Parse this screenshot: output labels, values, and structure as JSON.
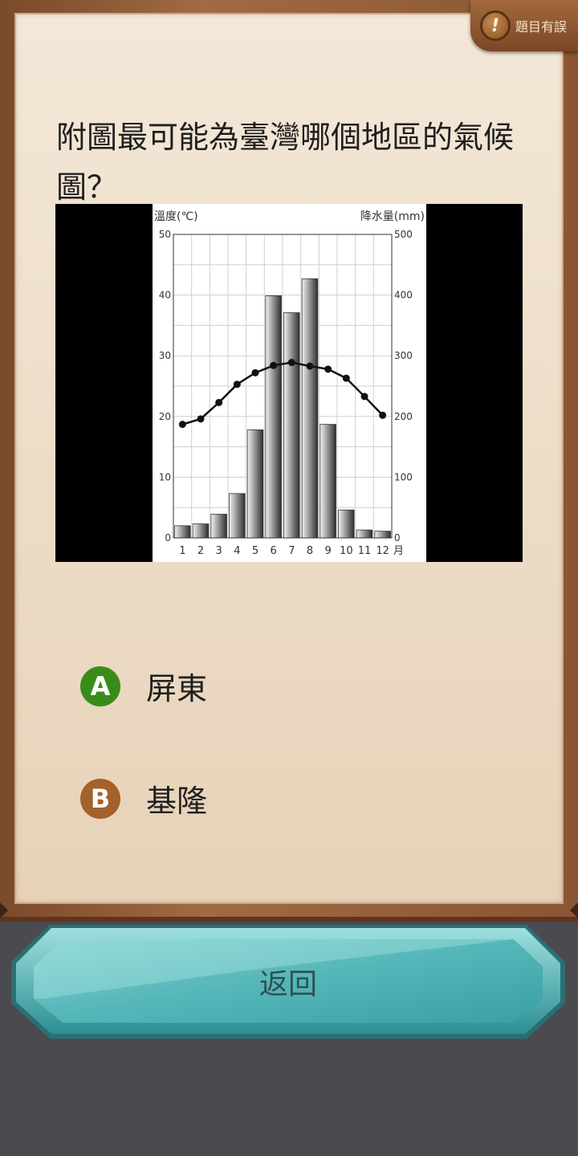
{
  "report": {
    "label": "題目有誤",
    "icon": "exclamation-icon"
  },
  "question": {
    "text": "附圖最可能為臺灣哪個地區的氣候圖？"
  },
  "chart_data": {
    "type": "bar+line",
    "title": "",
    "left_axis_label": "溫度(℃)",
    "right_axis_label": "降水量(mm)",
    "x_label": "月",
    "categories": [
      "1",
      "2",
      "3",
      "4",
      "5",
      "6",
      "7",
      "8",
      "9",
      "10",
      "11",
      "12"
    ],
    "left_ticks": [
      "0",
      "10",
      "20",
      "30",
      "40",
      "50"
    ],
    "right_ticks": [
      "0",
      "100",
      "200",
      "300",
      "400",
      "500"
    ],
    "left_ylim": [
      0,
      50
    ],
    "right_ylim": [
      0,
      500
    ],
    "grid": true,
    "series": [
      {
        "kind": "bar",
        "axis": "right",
        "values": [
          20,
          23,
          39,
          73,
          178,
          399,
          371,
          427,
          187,
          46,
          13,
          11
        ]
      },
      {
        "kind": "line",
        "axis": "left",
        "values": [
          18.7,
          19.6,
          22.3,
          25.3,
          27.2,
          28.4,
          28.9,
          28.3,
          27.8,
          26.3,
          23.3,
          20.2
        ]
      }
    ]
  },
  "options": [
    {
      "letter": "A",
      "text": "屏東"
    },
    {
      "letter": "B",
      "text": "基隆"
    }
  ],
  "back": {
    "label": "返回"
  }
}
